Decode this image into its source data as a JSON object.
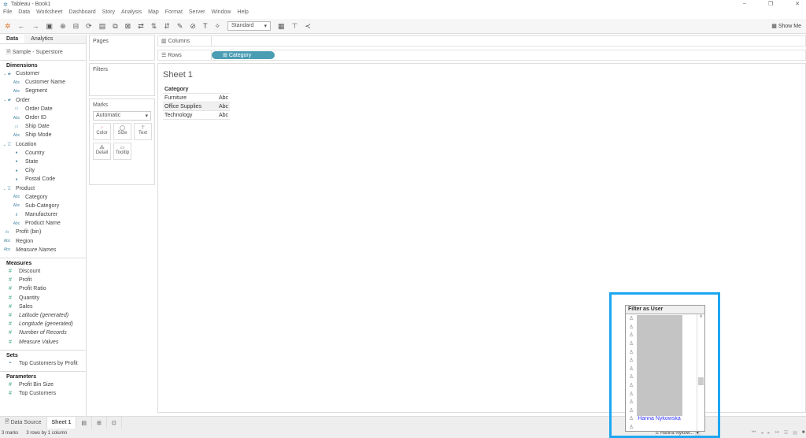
{
  "window": {
    "title": "Tableau - Book1",
    "min": "–",
    "restore": "❐",
    "close": "✕"
  },
  "menu": [
    "File",
    "Data",
    "Worksheet",
    "Dashboard",
    "Story",
    "Analysis",
    "Map",
    "Format",
    "Server",
    "Window",
    "Help"
  ],
  "toolbar": {
    "fit": "Standard",
    "show_me": "Show Me"
  },
  "left": {
    "tabs": [
      "Data",
      "Analytics"
    ],
    "source": "Sample - Superstore",
    "dimensions_label": "Dimensions",
    "dimensions": [
      {
        "label": "Customer",
        "icon": "folder",
        "lvl": 0
      },
      {
        "label": "Customer Name",
        "icon": "Abc",
        "lvl": 1
      },
      {
        "label": "Segment",
        "icon": "Abc",
        "lvl": 1
      },
      {
        "label": "Order",
        "icon": "folder",
        "lvl": 0
      },
      {
        "label": "Order Date",
        "icon": "date",
        "lvl": 1
      },
      {
        "label": "Order ID",
        "icon": "Abc",
        "lvl": 1
      },
      {
        "label": "Ship Date",
        "icon": "date",
        "lvl": 1
      },
      {
        "label": "Ship Mode",
        "icon": "Abc",
        "lvl": 1
      },
      {
        "label": "Location",
        "icon": "hier",
        "lvl": 0
      },
      {
        "label": "Country",
        "icon": "globe",
        "lvl": 1
      },
      {
        "label": "State",
        "icon": "globe",
        "lvl": 1
      },
      {
        "label": "City",
        "icon": "globe",
        "lvl": 1
      },
      {
        "label": "Postal Code",
        "icon": "globe",
        "lvl": 1
      },
      {
        "label": "Product",
        "icon": "hier",
        "lvl": 0
      },
      {
        "label": "Category",
        "icon": "Abc",
        "lvl": 1
      },
      {
        "label": "Sub-Category",
        "icon": "Abc",
        "lvl": 1
      },
      {
        "label": "Manufacturer",
        "icon": "link",
        "lvl": 1
      },
      {
        "label": "Product Name",
        "icon": "Abc",
        "lvl": 1
      },
      {
        "label": "Profit (bin)",
        "icon": "bin",
        "lvl": 2
      },
      {
        "label": "Region",
        "icon": "Abc",
        "lvl": 2
      },
      {
        "label": "Measure Names",
        "icon": "Abc",
        "lvl": 2,
        "italic": true
      }
    ],
    "measures_label": "Measures",
    "measures": [
      {
        "label": "Discount"
      },
      {
        "label": "Profit"
      },
      {
        "label": "Profit Ratio"
      },
      {
        "label": "Quantity"
      },
      {
        "label": "Sales"
      },
      {
        "label": "Latitude (generated)",
        "italic": true
      },
      {
        "label": "Longitude (generated)",
        "italic": true
      },
      {
        "label": "Number of Records",
        "italic": true
      },
      {
        "label": "Measure Values",
        "italic": true
      }
    ],
    "sets_label": "Sets",
    "sets": [
      "Top Customers by Profit"
    ],
    "params_label": "Parameters",
    "params": [
      "Profit Bin Size",
      "Top Customers"
    ]
  },
  "shelves": {
    "pages": "Pages",
    "filters": "Filters",
    "marks": "Marks",
    "mark_type": "Automatic",
    "mark_buttons": [
      "Color",
      "Size",
      "Text",
      "Detail",
      "Tooltip"
    ],
    "columns": "Columns",
    "rows": "Rows",
    "rows_pill": "Category"
  },
  "view": {
    "title": "Sheet 1",
    "header": "Category",
    "rows": [
      {
        "name": "Furniture",
        "val": "Abc"
      },
      {
        "name": "Office Supplies",
        "val": "Abc"
      },
      {
        "name": "Technology",
        "val": "Abc"
      }
    ]
  },
  "tabs": {
    "data_source": "Data Source",
    "sheet": "Sheet 1"
  },
  "status": {
    "marks": "3 marks",
    "dims": "3 rows by 1 column"
  },
  "filter_user": {
    "title": "Filter as User",
    "selected_name": "Hanna Nykowska",
    "current": "Hanna Nykow..."
  },
  "accent": "#1ea7f0"
}
